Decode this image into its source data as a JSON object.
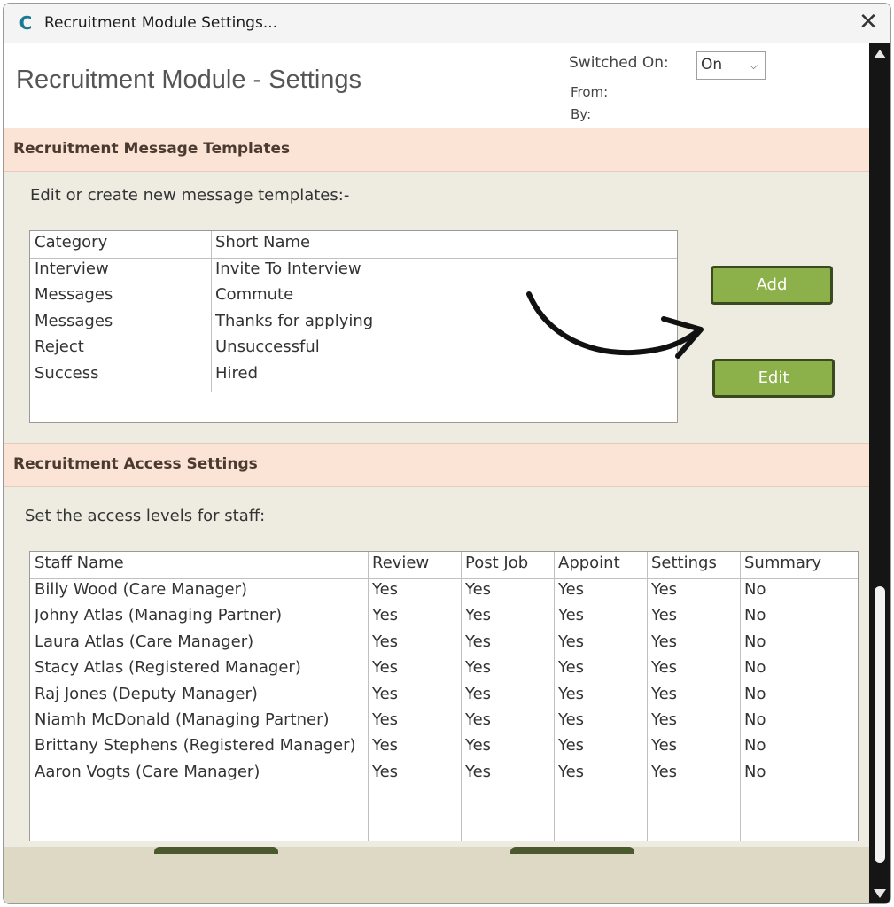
{
  "window": {
    "title": "Recruitment Module Settings...",
    "app_icon_glyph": "C",
    "close_glyph": "✕"
  },
  "header": {
    "title": "Recruitment Module - Settings",
    "switched_on_label": "Switched On:",
    "switched_on_value": "On",
    "from_label": "From:",
    "by_label": "By:"
  },
  "templates": {
    "section_title": "Recruitment Message Templates",
    "hint": "Edit or create new message templates:-",
    "columns": [
      "Category",
      "Short Name"
    ],
    "rows": [
      [
        "Interview",
        "Invite To Interview"
      ],
      [
        "Messages",
        "Commute"
      ],
      [
        "Messages",
        "Thanks for applying"
      ],
      [
        "Reject",
        "Unsuccessful"
      ],
      [
        "Success",
        "Hired"
      ]
    ],
    "add_label": "Add",
    "edit_label": "Edit"
  },
  "access": {
    "section_title": "Recruitment Access Settings",
    "hint": "Set the access levels for staff:",
    "columns": [
      "Staff Name",
      "Review",
      "Post Job",
      "Appoint",
      "Settings",
      "Summary"
    ],
    "rows": [
      [
        "Billy Wood (Care Manager)",
        "Yes",
        "Yes",
        "Yes",
        "Yes",
        "No"
      ],
      [
        "Johny Atlas (Managing Partner)",
        "Yes",
        "Yes",
        "Yes",
        "Yes",
        "No"
      ],
      [
        "Laura Atlas (Care Manager)",
        "Yes",
        "Yes",
        "Yes",
        "Yes",
        "No"
      ],
      [
        "Stacy Atlas (Registered Manager)",
        "Yes",
        "Yes",
        "Yes",
        "Yes",
        "No"
      ],
      [
        "Raj Jones (Deputy Manager)",
        "Yes",
        "Yes",
        "Yes",
        "Yes",
        "No"
      ],
      [
        "Niamh McDonald (Managing Partner)",
        "Yes",
        "Yes",
        "Yes",
        "Yes",
        "No"
      ],
      [
        "Brittany Stephens (Registered Manager)",
        "Yes",
        "Yes",
        "Yes",
        "Yes",
        "No"
      ],
      [
        "Aaron Vogts (Care Manager)",
        "Yes",
        "Yes",
        "Yes",
        "Yes",
        "No"
      ]
    ]
  },
  "colors": {
    "accent_green": "#8db14a",
    "section_header": "#fbe4d6",
    "panel_bg": "#eeece1"
  }
}
